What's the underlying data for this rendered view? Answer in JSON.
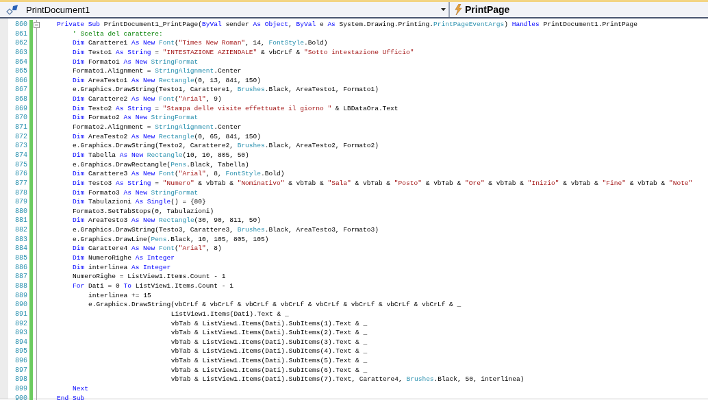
{
  "navigation_bar": {
    "class_combo": {
      "value": "PrintDocument1"
    },
    "method_combo": {
      "value": "PrintPage"
    }
  },
  "editor": {
    "lines": [
      {
        "number": "860",
        "changed": true,
        "collapsible": true,
        "tokens": [
          {
            "kind": "keyword",
            "text": "Private Sub"
          },
          {
            "kind": "plain",
            "text": " PrintDocument1_PrintPage("
          },
          {
            "kind": "keyword",
            "text": "ByVal"
          },
          {
            "kind": "plain",
            "text": " sender "
          },
          {
            "kind": "keyword",
            "text": "As Object"
          },
          {
            "kind": "plain",
            "text": ", "
          },
          {
            "kind": "keyword",
            "text": "ByVal"
          },
          {
            "kind": "plain",
            "text": " e "
          },
          {
            "kind": "keyword",
            "text": "As"
          },
          {
            "kind": "plain",
            "text": " System.Drawing.Printing."
          },
          {
            "kind": "type",
            "text": "PrintPageEventArgs"
          },
          {
            "kind": "plain",
            "text": ") "
          },
          {
            "kind": "keyword",
            "text": "Handles"
          },
          {
            "kind": "plain",
            "text": " PrintDocument1.PrintPage"
          }
        ],
        "children": [
          {
            "number": "861",
            "changed": true,
            "collapsible": false,
            "tokens": [
              {
                "kind": "comment",
                "text": "' Scelta del carattere:"
              }
            ]
          },
          {
            "number": "862",
            "changed": true,
            "collapsible": false,
            "tokens": [
              {
                "kind": "keyword",
                "text": "Dim"
              },
              {
                "kind": "plain",
                "text": " Carattere1 "
              },
              {
                "kind": "keyword",
                "text": "As New "
              },
              {
                "kind": "type",
                "text": "Font"
              },
              {
                "kind": "plain",
                "text": "("
              },
              {
                "kind": "string",
                "text": "\"Times New Roman\""
              },
              {
                "kind": "plain",
                "text": ", 14, "
              },
              {
                "kind": "type",
                "text": "FontStyle"
              },
              {
                "kind": "plain",
                "text": ".Bold)"
              }
            ]
          },
          {
            "number": "863",
            "changed": true,
            "collapsible": false,
            "tokens": [
              {
                "kind": "keyword",
                "text": "Dim"
              },
              {
                "kind": "plain",
                "text": " Testo1 "
              },
              {
                "kind": "keyword",
                "text": "As String"
              },
              {
                "kind": "plain",
                "text": " = "
              },
              {
                "kind": "string",
                "text": "\"INTESTAZIONE AZIENDALE\""
              },
              {
                "kind": "plain",
                "text": " & vbCrLf & "
              },
              {
                "kind": "string",
                "text": "\"Sotto intestazione Ufficio\""
              }
            ]
          },
          {
            "number": "864",
            "changed": true,
            "collapsible": false,
            "tokens": [
              {
                "kind": "keyword",
                "text": "Dim"
              },
              {
                "kind": "plain",
                "text": " Formato1 "
              },
              {
                "kind": "keyword",
                "text": "As New "
              },
              {
                "kind": "type",
                "text": "StringFormat"
              }
            ]
          },
          {
            "number": "865",
            "changed": true,
            "collapsible": false,
            "tokens": [
              {
                "kind": "plain",
                "text": "Formato1.Alignment = "
              },
              {
                "kind": "type",
                "text": "StringAlignment"
              },
              {
                "kind": "plain",
                "text": ".Center"
              }
            ]
          },
          {
            "number": "866",
            "changed": true,
            "collapsible": false,
            "tokens": [
              {
                "kind": "keyword",
                "text": "Dim"
              },
              {
                "kind": "plain",
                "text": " AreaTesto1 "
              },
              {
                "kind": "keyword",
                "text": "As New "
              },
              {
                "kind": "type",
                "text": "Rectangle"
              },
              {
                "kind": "plain",
                "text": "(0, 13, 841, 150)"
              }
            ]
          },
          {
            "number": "867",
            "changed": true,
            "collapsible": false,
            "tokens": [
              {
                "kind": "plain",
                "text": "e.Graphics.DrawString(Testo1, Carattere1, "
              },
              {
                "kind": "type",
                "text": "Brushes"
              },
              {
                "kind": "plain",
                "text": ".Black, AreaTesto1, Formato1)"
              }
            ]
          },
          {
            "number": "868",
            "changed": true,
            "collapsible": false,
            "tokens": [
              {
                "kind": "keyword",
                "text": "Dim"
              },
              {
                "kind": "plain",
                "text": " Carattere2 "
              },
              {
                "kind": "keyword",
                "text": "As New "
              },
              {
                "kind": "type",
                "text": "Font"
              },
              {
                "kind": "plain",
                "text": "("
              },
              {
                "kind": "string",
                "text": "\"Arial\""
              },
              {
                "kind": "plain",
                "text": ", 9)"
              }
            ]
          },
          {
            "number": "869",
            "changed": true,
            "collapsible": false,
            "tokens": [
              {
                "kind": "keyword",
                "text": "Dim"
              },
              {
                "kind": "plain",
                "text": " Testo2 "
              },
              {
                "kind": "keyword",
                "text": "As String"
              },
              {
                "kind": "plain",
                "text": " = "
              },
              {
                "kind": "string",
                "text": "\"Stampa delle visite effettuate il giorno \""
              },
              {
                "kind": "plain",
                "text": " & LBDataOra.Text"
              }
            ]
          },
          {
            "number": "870",
            "changed": true,
            "collapsible": false,
            "tokens": [
              {
                "kind": "keyword",
                "text": "Dim"
              },
              {
                "kind": "plain",
                "text": " Formato2 "
              },
              {
                "kind": "keyword",
                "text": "As New "
              },
              {
                "kind": "type",
                "text": "StringFormat"
              }
            ]
          },
          {
            "number": "871",
            "changed": true,
            "collapsible": false,
            "tokens": [
              {
                "kind": "plain",
                "text": "Formato2.Alignment = "
              },
              {
                "kind": "type",
                "text": "StringAlignment"
              },
              {
                "kind": "plain",
                "text": ".Center"
              }
            ]
          },
          {
            "number": "872",
            "changed": true,
            "collapsible": false,
            "tokens": [
              {
                "kind": "keyword",
                "text": "Dim"
              },
              {
                "kind": "plain",
                "text": " AreaTesto2 "
              },
              {
                "kind": "keyword",
                "text": "As New "
              },
              {
                "kind": "type",
                "text": "Rectangle"
              },
              {
                "kind": "plain",
                "text": "(0, 65, 841, 150)"
              }
            ]
          },
          {
            "number": "873",
            "changed": true,
            "collapsible": false,
            "tokens": [
              {
                "kind": "plain",
                "text": "e.Graphics.DrawString(Testo2, Carattere2, "
              },
              {
                "kind": "type",
                "text": "Brushes"
              },
              {
                "kind": "plain",
                "text": ".Black, AreaTesto2, Formato2)"
              }
            ]
          },
          {
            "number": "874",
            "changed": true,
            "collapsible": false,
            "tokens": [
              {
                "kind": "keyword",
                "text": "Dim"
              },
              {
                "kind": "plain",
                "text": " Tabella "
              },
              {
                "kind": "keyword",
                "text": "As New "
              },
              {
                "kind": "type",
                "text": "Rectangle"
              },
              {
                "kind": "plain",
                "text": "(10, 10, 805, 50)"
              }
            ]
          },
          {
            "number": "875",
            "changed": true,
            "collapsible": false,
            "tokens": [
              {
                "kind": "plain",
                "text": "e.Graphics.DrawRectangle("
              },
              {
                "kind": "type",
                "text": "Pens"
              },
              {
                "kind": "plain",
                "text": ".Black, Tabella)"
              }
            ]
          },
          {
            "number": "876",
            "changed": true,
            "collapsible": false,
            "tokens": [
              {
                "kind": "keyword",
                "text": "Dim"
              },
              {
                "kind": "plain",
                "text": " Carattere3 "
              },
              {
                "kind": "keyword",
                "text": "As New "
              },
              {
                "kind": "type",
                "text": "Font"
              },
              {
                "kind": "plain",
                "text": "("
              },
              {
                "kind": "string",
                "text": "\"Arial\""
              },
              {
                "kind": "plain",
                "text": ", 8, "
              },
              {
                "kind": "type",
                "text": "FontStyle"
              },
              {
                "kind": "plain",
                "text": ".Bold)"
              }
            ]
          },
          {
            "number": "877",
            "changed": true,
            "collapsible": false,
            "tokens": [
              {
                "kind": "keyword",
                "text": "Dim"
              },
              {
                "kind": "plain",
                "text": " Testo3 "
              },
              {
                "kind": "keyword",
                "text": "As String"
              },
              {
                "kind": "plain",
                "text": " = "
              },
              {
                "kind": "string",
                "text": "\"Numero\""
              },
              {
                "kind": "plain",
                "text": " & vbTab & "
              },
              {
                "kind": "string",
                "text": "\"Nominativo\""
              },
              {
                "kind": "plain",
                "text": " & vbTab & "
              },
              {
                "kind": "string",
                "text": "\"Sala\""
              },
              {
                "kind": "plain",
                "text": " & vbTab & "
              },
              {
                "kind": "string",
                "text": "\"Posto\""
              },
              {
                "kind": "plain",
                "text": " & vbTab & "
              },
              {
                "kind": "string",
                "text": "\"Ore\""
              },
              {
                "kind": "plain",
                "text": " & vbTab & "
              },
              {
                "kind": "string",
                "text": "\"Inizio\""
              },
              {
                "kind": "plain",
                "text": " & vbTab & "
              },
              {
                "kind": "string",
                "text": "\"Fine\""
              },
              {
                "kind": "plain",
                "text": " & vbTab & "
              },
              {
                "kind": "string",
                "text": "\"Note\""
              }
            ]
          },
          {
            "number": "878",
            "changed": true,
            "collapsible": false,
            "tokens": [
              {
                "kind": "keyword",
                "text": "Dim"
              },
              {
                "kind": "plain",
                "text": " Formato3 "
              },
              {
                "kind": "keyword",
                "text": "As New "
              },
              {
                "kind": "type",
                "text": "StringFormat"
              }
            ]
          },
          {
            "number": "879",
            "changed": true,
            "collapsible": false,
            "tokens": [
              {
                "kind": "keyword",
                "text": "Dim"
              },
              {
                "kind": "plain",
                "text": " Tabulazioni "
              },
              {
                "kind": "keyword",
                "text": "As Single"
              },
              {
                "kind": "plain",
                "text": "() = {80}"
              }
            ]
          },
          {
            "number": "880",
            "changed": true,
            "collapsible": false,
            "tokens": [
              {
                "kind": "plain",
                "text": "Formato3.SetTabStops(0, Tabulazioni)"
              }
            ]
          },
          {
            "number": "881",
            "changed": true,
            "collapsible": false,
            "tokens": [
              {
                "kind": "keyword",
                "text": "Dim"
              },
              {
                "kind": "plain",
                "text": " AreaTesto3 "
              },
              {
                "kind": "keyword",
                "text": "As New "
              },
              {
                "kind": "type",
                "text": "Rectangle"
              },
              {
                "kind": "plain",
                "text": "(30, 90, 811, 50)"
              }
            ]
          },
          {
            "number": "882",
            "changed": true,
            "collapsible": false,
            "tokens": [
              {
                "kind": "plain",
                "text": "e.Graphics.DrawString(Testo3, Carattere3, "
              },
              {
                "kind": "type",
                "text": "Brushes"
              },
              {
                "kind": "plain",
                "text": ".Black, AreaTesto3, Formato3)"
              }
            ]
          },
          {
            "number": "883",
            "changed": true,
            "collapsible": false,
            "tokens": [
              {
                "kind": "plain",
                "text": "e.Graphics.DrawLine("
              },
              {
                "kind": "type",
                "text": "Pens"
              },
              {
                "kind": "plain",
                "text": ".Black, 10, 105, 805, 105)"
              }
            ]
          },
          {
            "number": "884",
            "changed": true,
            "collapsible": false,
            "tokens": [
              {
                "kind": "keyword",
                "text": "Dim"
              },
              {
                "kind": "plain",
                "text": " Carattere4 "
              },
              {
                "kind": "keyword",
                "text": "As New "
              },
              {
                "kind": "type",
                "text": "Font"
              },
              {
                "kind": "plain",
                "text": "("
              },
              {
                "kind": "string",
                "text": "\"Arial\""
              },
              {
                "kind": "plain",
                "text": ", 8)"
              }
            ]
          },
          {
            "number": "885",
            "changed": true,
            "collapsible": false,
            "tokens": [
              {
                "kind": "keyword",
                "text": "Dim"
              },
              {
                "kind": "plain",
                "text": " NumeroRighe "
              },
              {
                "kind": "keyword",
                "text": "As Integer"
              }
            ]
          },
          {
            "number": "886",
            "changed": true,
            "collapsible": false,
            "tokens": [
              {
                "kind": "keyword",
                "text": "Dim"
              },
              {
                "kind": "plain",
                "text": " interlinea "
              },
              {
                "kind": "keyword",
                "text": "As Integer"
              }
            ]
          },
          {
            "number": "887",
            "changed": true,
            "collapsible": false,
            "tokens": [
              {
                "kind": "plain",
                "text": "NumeroRighe = ListView1.Items.Count - 1"
              }
            ]
          },
          {
            "number": "888",
            "changed": true,
            "collapsible": false,
            "tokens": [
              {
                "kind": "keyword",
                "text": "For"
              },
              {
                "kind": "plain",
                "text": " Dati = 0 "
              },
              {
                "kind": "keyword",
                "text": "To"
              },
              {
                "kind": "plain",
                "text": " ListView1.Items.Count - 1"
              }
            ],
            "children": [
              {
                "number": "889",
                "changed": true,
                "collapsible": false,
                "tokens": [
                  {
                    "kind": "plain",
                    "text": "interlinea += 15"
                  }
                ]
              },
              {
                "number": "890",
                "changed": true,
                "collapsible": false,
                "tokens": [
                  {
                    "kind": "plain",
                    "text": "e.Graphics.DrawString(vbCrLf & vbCrLf & vbCrLf & vbCrLf & vbCrLf & vbCrLf & vbCrLf & vbCrLf & _"
                  }
                ],
                "children": [
                  {
                    "number": "891",
                    "changed": true,
                    "collapsible": false,
                    "tokens": [
                      {
                        "kind": "plain",
                        "text": "ListView1.Items(Dati).Text & _"
                      }
                    ]
                  },
                  {
                    "number": "892",
                    "changed": true,
                    "collapsible": false,
                    "tokens": [
                      {
                        "kind": "plain",
                        "text": "vbTab & ListView1.Items(Dati).SubItems(1).Text & _"
                      }
                    ]
                  },
                  {
                    "number": "893",
                    "changed": true,
                    "collapsible": false,
                    "tokens": [
                      {
                        "kind": "plain",
                        "text": "vbTab & ListView1.Items(Dati).SubItems(2).Text & _"
                      }
                    ]
                  },
                  {
                    "number": "894",
                    "changed": true,
                    "collapsible": false,
                    "tokens": [
                      {
                        "kind": "plain",
                        "text": "vbTab & ListView1.Items(Dati).SubItems(3).Text & _"
                      }
                    ]
                  },
                  {
                    "number": "895",
                    "changed": true,
                    "collapsible": false,
                    "tokens": [
                      {
                        "kind": "plain",
                        "text": "vbTab & ListView1.Items(Dati).SubItems(4).Text & _"
                      }
                    ]
                  },
                  {
                    "number": "896",
                    "changed": true,
                    "collapsible": false,
                    "tokens": [
                      {
                        "kind": "plain",
                        "text": "vbTab & ListView1.Items(Dati).SubItems(5).Text & _"
                      }
                    ]
                  },
                  {
                    "number": "897",
                    "changed": true,
                    "collapsible": false,
                    "tokens": [
                      {
                        "kind": "plain",
                        "text": "vbTab & ListView1.Items(Dati).SubItems(6).Text & _"
                      }
                    ]
                  },
                  {
                    "number": "898",
                    "changed": true,
                    "collapsible": false,
                    "tokens": [
                      {
                        "kind": "plain",
                        "text": "vbTab & ListView1.Items(Dati).SubItems(7).Text, Carattere4, "
                      },
                      {
                        "kind": "type",
                        "text": "Brushes"
                      },
                      {
                        "kind": "plain",
                        "text": ".Black, 50, interlinea)"
                      }
                    ]
                  }
                ]
              }
            ]
          },
          {
            "number": "899",
            "changed": true,
            "collapsible": false,
            "tokens": [
              {
                "kind": "keyword",
                "text": "Next"
              }
            ]
          }
        ]
      },
      {
        "number": "900",
        "changed": true,
        "collapsible": false,
        "tokens": [
          {
            "kind": "keyword",
            "text": "End Sub"
          }
        ]
      }
    ]
  }
}
